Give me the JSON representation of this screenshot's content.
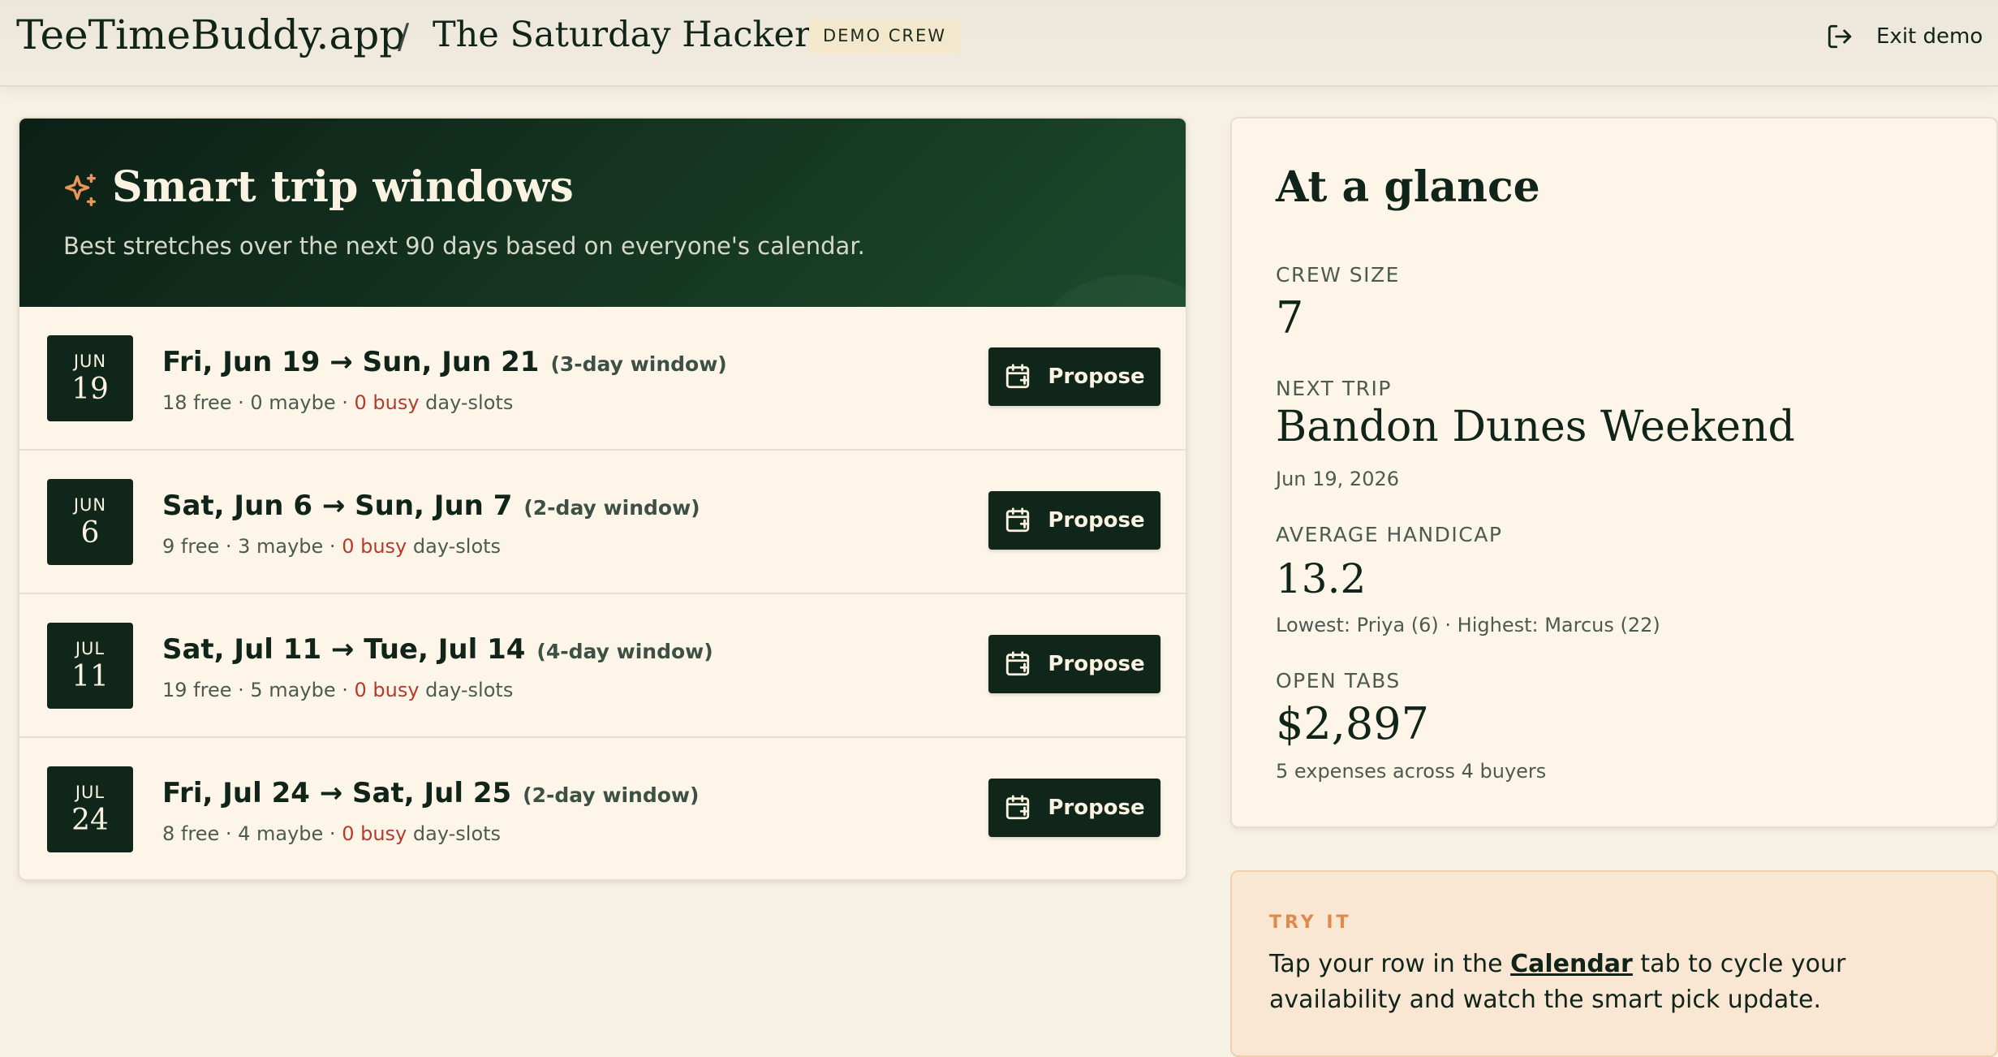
{
  "topbar": {
    "brand": "TeeTimeBuddy.app",
    "separator": "/",
    "crew_name": "The Saturday Hackers",
    "badge": "DEMO CREW",
    "exit_label": "Exit demo",
    "exit_icon": "logout-icon"
  },
  "windows": {
    "icon": "sparkle-icon",
    "title": "Smart trip windows",
    "subtitle": "Best stretches over the next 90 days based on everyone's calendar.",
    "propose_label": "Propose",
    "propose_icon": "calendar-plus-icon",
    "rows": [
      {
        "month": "JUN",
        "day": "19",
        "range": "Fri, Jun 19 → Sun, Jun 21",
        "window": "(3-day window)",
        "free": "18 free",
        "maybe": "0 maybe",
        "busy": "0 busy",
        "suffix": "day-slots"
      },
      {
        "month": "JUN",
        "day": "6",
        "range": "Sat, Jun 6 → Sun, Jun 7",
        "window": "(2-day window)",
        "free": "9 free",
        "maybe": "3 maybe",
        "busy": "0 busy",
        "suffix": "day-slots"
      },
      {
        "month": "JUL",
        "day": "11",
        "range": "Sat, Jul 11 → Tue, Jul 14",
        "window": "(4-day window)",
        "free": "19 free",
        "maybe": "5 maybe",
        "busy": "0 busy",
        "suffix": "day-slots"
      },
      {
        "month": "JUL",
        "day": "24",
        "range": "Fri, Jul 24 → Sat, Jul 25",
        "window": "(2-day window)",
        "free": "8 free",
        "maybe": "4 maybe",
        "busy": "0 busy",
        "suffix": "day-slots"
      }
    ]
  },
  "glance": {
    "title": "At a glance",
    "crew_size_label": "CREW SIZE",
    "crew_size": "7",
    "next_trip_label": "NEXT TRIP",
    "next_trip": "Bandon Dunes Weekend",
    "next_trip_date": "Jun 19, 2026",
    "handicap_label": "AVERAGE HANDICAP",
    "handicap": "13.2",
    "handicap_note": "Lowest: Priya (6) · Highest: Marcus (22)",
    "tabs_label": "OPEN TABS",
    "tabs_value": "$2,897",
    "tabs_note": "5 expenses across 4 buyers"
  },
  "tryit": {
    "label": "TRY IT",
    "text_before": "Tap your row in the ",
    "link": "Calendar",
    "text_after": " tab to cycle your availability and watch the smart pick update."
  },
  "colors": {
    "forest": "#10261a",
    "cream": "#fdf6e8",
    "busy_red": "#b43a2e",
    "accent_orange": "#e08a4a"
  }
}
